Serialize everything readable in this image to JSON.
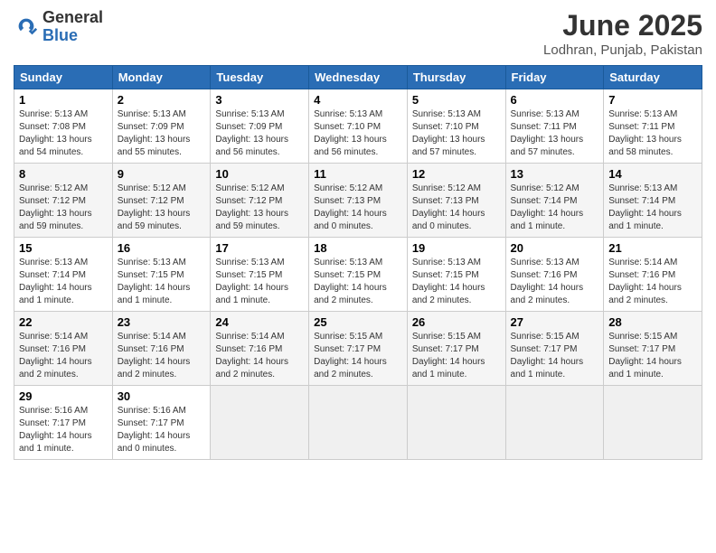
{
  "header": {
    "logo_general": "General",
    "logo_blue": "Blue",
    "month_title": "June 2025",
    "location": "Lodhran, Punjab, Pakistan"
  },
  "days_of_week": [
    "Sunday",
    "Monday",
    "Tuesday",
    "Wednesday",
    "Thursday",
    "Friday",
    "Saturday"
  ],
  "weeks": [
    [
      {
        "day": "1",
        "sunrise": "5:13 AM",
        "sunset": "7:08 PM",
        "daylight": "13 hours and 54 minutes."
      },
      {
        "day": "2",
        "sunrise": "5:13 AM",
        "sunset": "7:09 PM",
        "daylight": "13 hours and 55 minutes."
      },
      {
        "day": "3",
        "sunrise": "5:13 AM",
        "sunset": "7:09 PM",
        "daylight": "13 hours and 56 minutes."
      },
      {
        "day": "4",
        "sunrise": "5:13 AM",
        "sunset": "7:10 PM",
        "daylight": "13 hours and 56 minutes."
      },
      {
        "day": "5",
        "sunrise": "5:13 AM",
        "sunset": "7:10 PM",
        "daylight": "13 hours and 57 minutes."
      },
      {
        "day": "6",
        "sunrise": "5:13 AM",
        "sunset": "7:11 PM",
        "daylight": "13 hours and 57 minutes."
      },
      {
        "day": "7",
        "sunrise": "5:13 AM",
        "sunset": "7:11 PM",
        "daylight": "13 hours and 58 minutes."
      }
    ],
    [
      {
        "day": "8",
        "sunrise": "5:12 AM",
        "sunset": "7:12 PM",
        "daylight": "13 hours and 59 minutes."
      },
      {
        "day": "9",
        "sunrise": "5:12 AM",
        "sunset": "7:12 PM",
        "daylight": "13 hours and 59 minutes."
      },
      {
        "day": "10",
        "sunrise": "5:12 AM",
        "sunset": "7:12 PM",
        "daylight": "13 hours and 59 minutes."
      },
      {
        "day": "11",
        "sunrise": "5:12 AM",
        "sunset": "7:13 PM",
        "daylight": "14 hours and 0 minutes."
      },
      {
        "day": "12",
        "sunrise": "5:12 AM",
        "sunset": "7:13 PM",
        "daylight": "14 hours and 0 minutes."
      },
      {
        "day": "13",
        "sunrise": "5:12 AM",
        "sunset": "7:14 PM",
        "daylight": "14 hours and 1 minute."
      },
      {
        "day": "14",
        "sunrise": "5:13 AM",
        "sunset": "7:14 PM",
        "daylight": "14 hours and 1 minute."
      }
    ],
    [
      {
        "day": "15",
        "sunrise": "5:13 AM",
        "sunset": "7:14 PM",
        "daylight": "14 hours and 1 minute."
      },
      {
        "day": "16",
        "sunrise": "5:13 AM",
        "sunset": "7:15 PM",
        "daylight": "14 hours and 1 minute."
      },
      {
        "day": "17",
        "sunrise": "5:13 AM",
        "sunset": "7:15 PM",
        "daylight": "14 hours and 1 minute."
      },
      {
        "day": "18",
        "sunrise": "5:13 AM",
        "sunset": "7:15 PM",
        "daylight": "14 hours and 2 minutes."
      },
      {
        "day": "19",
        "sunrise": "5:13 AM",
        "sunset": "7:15 PM",
        "daylight": "14 hours and 2 minutes."
      },
      {
        "day": "20",
        "sunrise": "5:13 AM",
        "sunset": "7:16 PM",
        "daylight": "14 hours and 2 minutes."
      },
      {
        "day": "21",
        "sunrise": "5:14 AM",
        "sunset": "7:16 PM",
        "daylight": "14 hours and 2 minutes."
      }
    ],
    [
      {
        "day": "22",
        "sunrise": "5:14 AM",
        "sunset": "7:16 PM",
        "daylight": "14 hours and 2 minutes."
      },
      {
        "day": "23",
        "sunrise": "5:14 AM",
        "sunset": "7:16 PM",
        "daylight": "14 hours and 2 minutes."
      },
      {
        "day": "24",
        "sunrise": "5:14 AM",
        "sunset": "7:16 PM",
        "daylight": "14 hours and 2 minutes."
      },
      {
        "day": "25",
        "sunrise": "5:15 AM",
        "sunset": "7:17 PM",
        "daylight": "14 hours and 2 minutes."
      },
      {
        "day": "26",
        "sunrise": "5:15 AM",
        "sunset": "7:17 PM",
        "daylight": "14 hours and 1 minute."
      },
      {
        "day": "27",
        "sunrise": "5:15 AM",
        "sunset": "7:17 PM",
        "daylight": "14 hours and 1 minute."
      },
      {
        "day": "28",
        "sunrise": "5:15 AM",
        "sunset": "7:17 PM",
        "daylight": "14 hours and 1 minute."
      }
    ],
    [
      {
        "day": "29",
        "sunrise": "5:16 AM",
        "sunset": "7:17 PM",
        "daylight": "14 hours and 1 minute."
      },
      {
        "day": "30",
        "sunrise": "5:16 AM",
        "sunset": "7:17 PM",
        "daylight": "14 hours and 0 minutes."
      },
      null,
      null,
      null,
      null,
      null
    ]
  ]
}
